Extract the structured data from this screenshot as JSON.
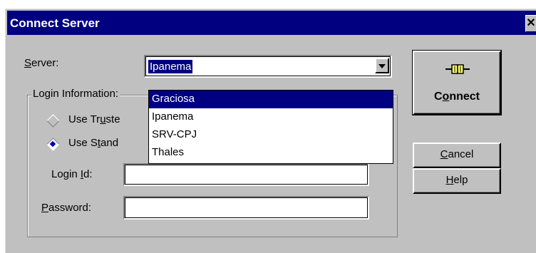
{
  "dialog": {
    "title": "Connect Server",
    "close_glyph": "✕"
  },
  "server": {
    "label_prefix": "",
    "label_access": "S",
    "label_rest": "erver:",
    "value": "Ipanema",
    "options": [
      "Graciosa",
      "Ipanema",
      "SRV-CPJ",
      "Thales"
    ],
    "highlighted_option": "Graciosa"
  },
  "login_group": {
    "legend": "Login Information:",
    "trusted_label_a": "Use Tr",
    "trusted_label_access": "u",
    "trusted_label_b": "ste",
    "trusted_selected": false,
    "standard_label_a": "Use S",
    "standard_label_access": "t",
    "standard_label_b": "and",
    "standard_selected": true,
    "login_id_label_a": "Login ",
    "login_id_label_access": "I",
    "login_id_label_b": "d:",
    "login_id_value": "",
    "password_label_access": "P",
    "password_label_b": "assword:",
    "password_value": ""
  },
  "buttons": {
    "connect_a": "C",
    "connect_access": "o",
    "connect_b": "nnect",
    "cancel_access": "C",
    "cancel_b": "ancel",
    "help_access": "H",
    "help_b": "elp"
  },
  "colors": {
    "titlebar": "#000080",
    "face": "#c0c0c0",
    "selection": "#000080"
  }
}
